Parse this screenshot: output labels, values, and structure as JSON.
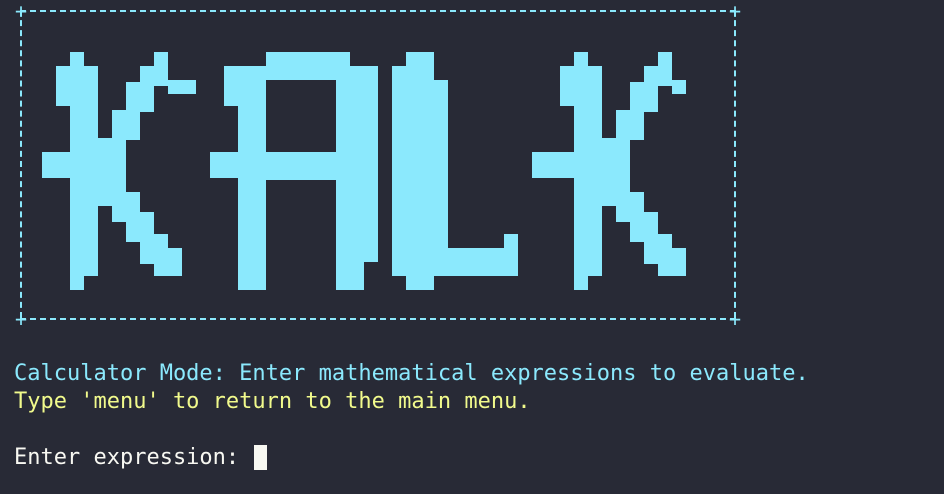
{
  "logo": {
    "text": "KALK",
    "color": "#8be9fd"
  },
  "frame": {
    "color": "#8be9fd",
    "corner_glyph": "+"
  },
  "messages": {
    "mode_line": "Calculator Mode: Enter mathematical expressions to evaluate.",
    "hint_line": "Type 'menu' to return to the main menu."
  },
  "prompt": {
    "label": "Enter expression: ",
    "value": ""
  },
  "colors": {
    "background": "#282a36",
    "cyan": "#8be9fd",
    "yellow": "#f1fa8c",
    "foreground": "#f8f8f2"
  }
}
